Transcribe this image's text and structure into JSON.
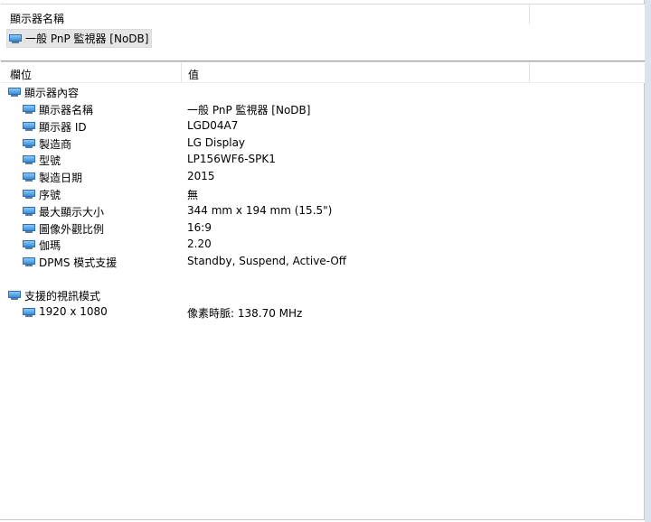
{
  "name_panel": {
    "header": "顯示器名稱",
    "selected_item": "一般 PnP 監視器 [NoDB]"
  },
  "grid": {
    "col_field": "欄位",
    "col_value": "值",
    "group_properties": "顯示器內容",
    "properties": [
      {
        "field": "顯示器名稱",
        "value": "一般 PnP 監視器 [NoDB]"
      },
      {
        "field": "顯示器 ID",
        "value": "LGD04A7"
      },
      {
        "field": "製造商",
        "value": "LG Display"
      },
      {
        "field": "型號",
        "value": "LP156WF6-SPK1"
      },
      {
        "field": "製造日期",
        "value": "2015"
      },
      {
        "field": "序號",
        "value": "無"
      },
      {
        "field": "最大顯示大小",
        "value": "344 mm x 194 mm (15.5\")"
      },
      {
        "field": "圖像外觀比例",
        "value": "16:9"
      },
      {
        "field": "伽瑪",
        "value": "2.20"
      },
      {
        "field": "DPMS 模式支援",
        "value": "Standby, Suspend, Active-Off"
      }
    ],
    "group_modes": "支援的視訊模式",
    "modes": [
      {
        "field": "1920 x 1080",
        "value": "像素時脈: 138.70 MHz"
      }
    ]
  },
  "icons": {
    "monitor": "monitor-icon"
  },
  "colors": {
    "icon_blue": "#3d8fd8",
    "selection_bg": "#e5e5e5"
  }
}
